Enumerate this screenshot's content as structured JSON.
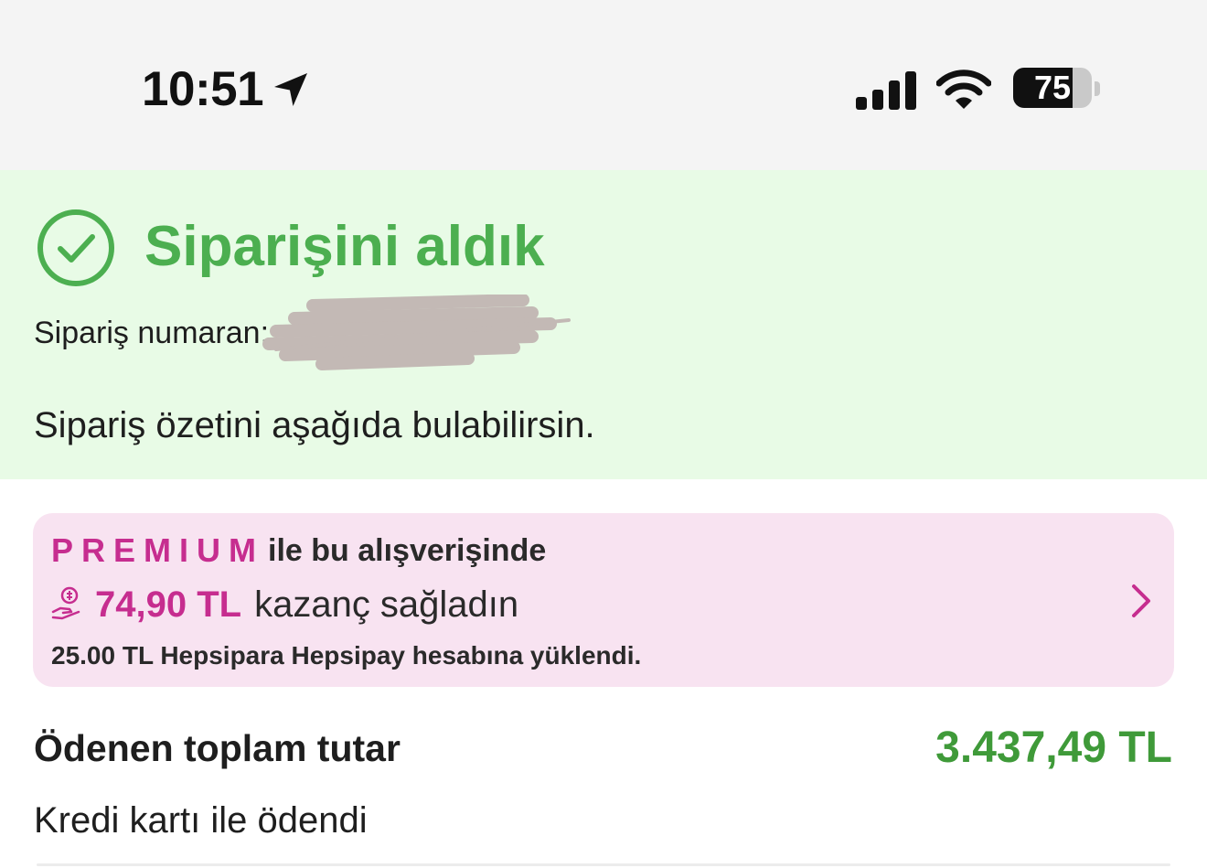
{
  "status_bar": {
    "time": "10:51",
    "battery_level": 75,
    "battery_label": "75",
    "icons": [
      "location-arrow-icon",
      "cellular-signal-icon",
      "wifi-icon",
      "battery-icon"
    ]
  },
  "banner": {
    "title": "Siparişini aldık",
    "order_number_label": "Sipariş numaran:",
    "summary": "Sipariş özetini aşağıda bulabilirsin.",
    "background_color": "#e8fbe6",
    "accent_color": "#4caf50",
    "icon": "check-circle-icon"
  },
  "premium": {
    "logo": "PREMIUM",
    "title_suffix": "ile bu alışverişinde",
    "savings_amount": "74,90 TL",
    "savings_text": "kazanç sağladın",
    "note": "25.00 TL Hepsipara Hepsipay hesabına yüklendi.",
    "brand_color": "#c62d8f",
    "background_color": "#f8e3f1",
    "icons": [
      "hand-coin-icon",
      "chevron-right-icon"
    ]
  },
  "payment": {
    "total_label": "Ödenen toplam tutar",
    "total_value": "3.437,49 TL",
    "total_color": "#3f9a39",
    "method": "Kredi kartı ile ödendi"
  }
}
